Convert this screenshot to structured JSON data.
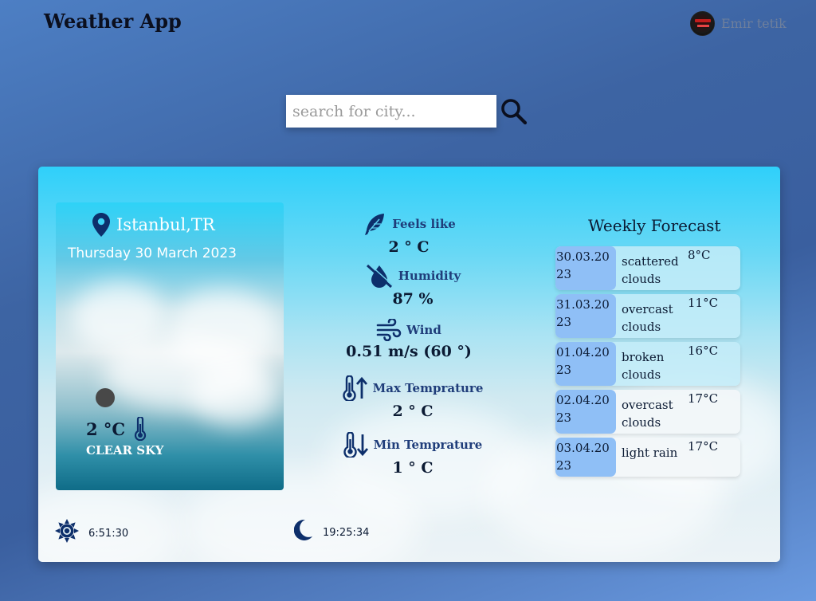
{
  "header": {
    "title": "Weather App",
    "user_name": "Emir tetik"
  },
  "search": {
    "placeholder": "search for city..."
  },
  "current": {
    "city": "Istanbul,TR",
    "date": "Thursday 30 March 2023",
    "temperature": "2 °C",
    "condition": "CLEAR SKY"
  },
  "stats": {
    "feels_like": {
      "label": "Feels like",
      "value": "2 ° C"
    },
    "humidity": {
      "label": "Humidity",
      "value": "87 %"
    },
    "wind": {
      "label": "Wind",
      "value": "0.51 m/s (60 °)"
    },
    "max_temp": {
      "label": "Max Temprature",
      "value": "2 ° C"
    },
    "min_temp": {
      "label": "Min Temprature",
      "value": "1 ° C"
    }
  },
  "forecast": {
    "title": "Weekly Forecast",
    "days": [
      {
        "date": "30.03.2023",
        "desc": "scattered clouds",
        "temp": "8°C"
      },
      {
        "date": "31.03.2023",
        "desc": "overcast clouds",
        "temp": "11°C"
      },
      {
        "date": "01.04.2023",
        "desc": "broken clouds",
        "temp": "16°C"
      },
      {
        "date": "02.04.2023",
        "desc": "overcast clouds",
        "temp": "17°C"
      },
      {
        "date": "03.04.2023",
        "desc": "light rain",
        "temp": "17°C"
      }
    ]
  },
  "sun": {
    "sunrise": "6:51:30",
    "sunset": "19:25:34"
  },
  "colors": {
    "accent_dark": "#0d2f6b",
    "date_chip": "#8fbff6",
    "card_top": "#2fd0fa"
  }
}
